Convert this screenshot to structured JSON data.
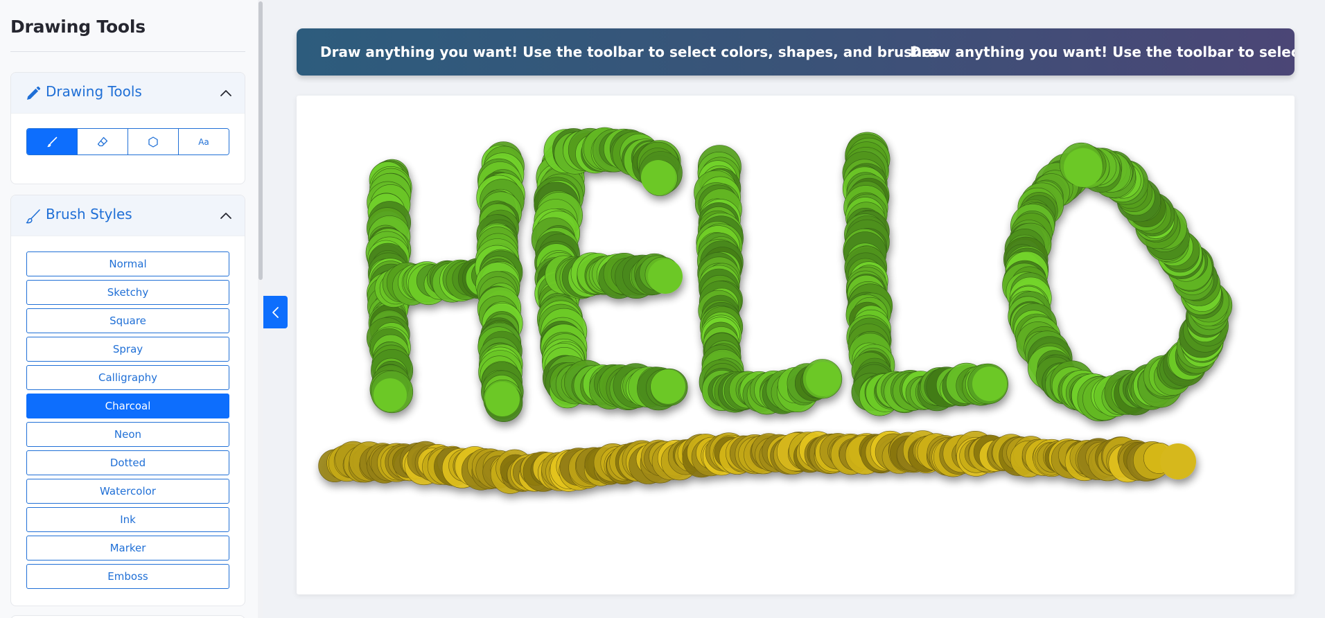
{
  "sidebar": {
    "title": "Drawing Tools",
    "drawing_panel": {
      "title": "Drawing Tools",
      "icon": "pencil-icon",
      "tools": [
        {
          "name": "brush",
          "icon": "brush-icon",
          "active": true
        },
        {
          "name": "eraser",
          "icon": "eraser-icon",
          "active": false
        },
        {
          "name": "shape",
          "icon": "hexagon-icon",
          "active": false
        },
        {
          "name": "text",
          "label": "Aa",
          "active": false
        }
      ]
    },
    "brush_panel": {
      "title": "Brush Styles",
      "icon": "brush-icon",
      "styles": [
        {
          "label": "Normal",
          "active": false
        },
        {
          "label": "Sketchy",
          "active": false
        },
        {
          "label": "Square",
          "active": false
        },
        {
          "label": "Spray",
          "active": false
        },
        {
          "label": "Calligraphy",
          "active": false
        },
        {
          "label": "Charcoal",
          "active": true
        },
        {
          "label": "Neon",
          "active": false
        },
        {
          "label": "Dotted",
          "active": false
        },
        {
          "label": "Watercolor",
          "active": false
        },
        {
          "label": "Ink",
          "active": false
        },
        {
          "label": "Marker",
          "active": false
        },
        {
          "label": "Emboss",
          "active": false
        }
      ]
    }
  },
  "banner": {
    "text": "Draw anything you want! Use the toolbar to select colors, shapes, and brushes."
  },
  "canvas": {
    "drawing_text": "HELLO",
    "stroke_colors": {
      "letters": "#6cc828",
      "underline": "#d6b81a"
    }
  },
  "colors": {
    "accent": "#0d6efd",
    "banner_start": "#2d5c7d",
    "banner_end": "#4b4676"
  }
}
